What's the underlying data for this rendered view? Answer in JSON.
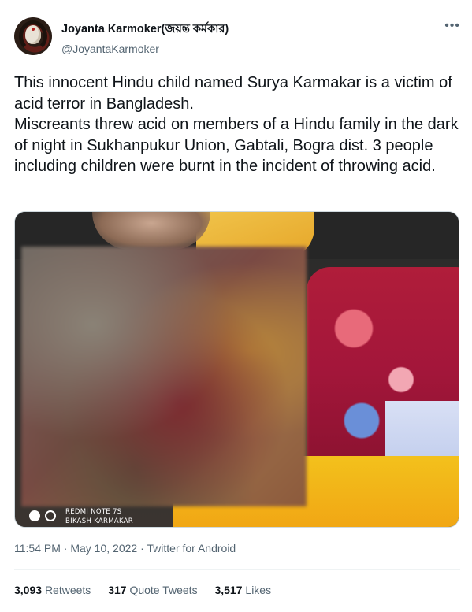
{
  "author": {
    "display_name": "Joyanta Karmoker(জয়ন্ত কর্মকার)",
    "handle": "@JoyantaKarmoker"
  },
  "more_icon": "more-horizontal-icon",
  "tweet": {
    "text": "This innocent Hindu child named Surya Karmakar is a victim of acid terror in Bangladesh.\nMiscreants threw acid on members of a Hindu family in the dark of night in Sukhanpukur Union, Gabtali, Bogra dist. 3 people including children were burnt in the incident of throwing acid."
  },
  "media": {
    "watermark_line1": "REDMI NOTE 7S",
    "watermark_line2": "BIKASH KARMAKAR"
  },
  "meta": {
    "time": "11:54 PM",
    "sep1": " · ",
    "date": "May 10, 2022",
    "sep2": " · ",
    "source": "Twitter for Android"
  },
  "stats": {
    "retweets_count": "3,093",
    "retweets_label": "Retweets",
    "quotes_count": "317",
    "quotes_label": "Quote Tweets",
    "likes_count": "3,517",
    "likes_label": "Likes"
  }
}
